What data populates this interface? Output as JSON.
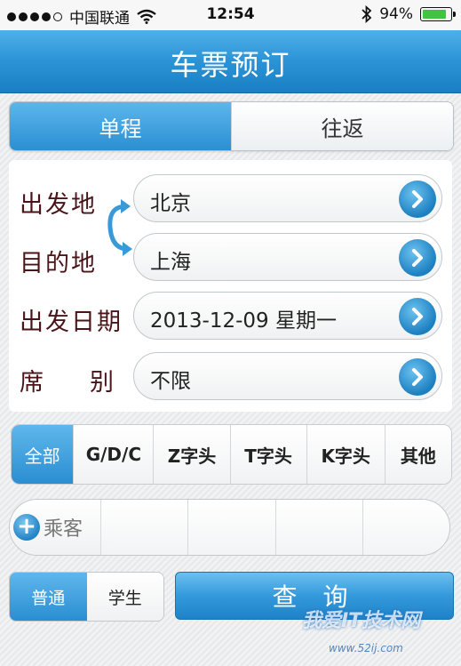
{
  "status_bar": {
    "carrier": "中国联通",
    "time": "12:54",
    "battery": "94%",
    "battery_level": 0.94
  },
  "header": {
    "title": "车票预订"
  },
  "trip_type": {
    "options": [
      "单程",
      "往返"
    ],
    "selected": "单程"
  },
  "form": {
    "from": {
      "label": "出发地",
      "value": "北京"
    },
    "to": {
      "label": "目的地",
      "value": "上海"
    },
    "date": {
      "label": "出发日期",
      "value": "2013-12-09 星期一"
    },
    "seat": {
      "label": "席别",
      "value": "不限"
    }
  },
  "train_filter": {
    "options": [
      "全部",
      "G/D/C",
      "Z字头",
      "T字头",
      "K字头",
      "其他"
    ],
    "selected": "全部"
  },
  "passengers": {
    "add_label": "乘客"
  },
  "passenger_type": {
    "options": [
      "普通",
      "学生"
    ],
    "selected": "普通"
  },
  "actions": {
    "query_label": "查 询"
  },
  "watermark": {
    "text": "我爱IT技术网",
    "sub": "www.52ij.com"
  },
  "colors": {
    "accent": "#2a93d6",
    "label_color": "#4a1418"
  }
}
